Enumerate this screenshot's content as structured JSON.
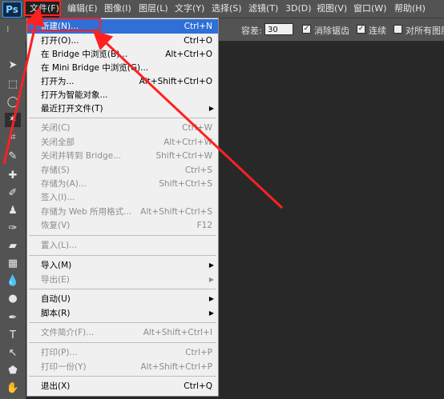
{
  "app": {
    "logo": "Ps"
  },
  "menubar": {
    "items": [
      "文件(F)",
      "编辑(E)",
      "图像(I)",
      "图层(L)",
      "文字(Y)",
      "选择(S)",
      "滤镜(T)",
      "3D(D)",
      "视图(V)",
      "窗口(W)",
      "帮助(H)"
    ]
  },
  "options": {
    "tolerance_label": "容差:",
    "tolerance_value": "30",
    "antialias_label": "消除锯齿",
    "contiguous_label": "连续",
    "all_layers_label": "对所有图层"
  },
  "file_menu": {
    "items": [
      {
        "label": "新建(N)...",
        "shortcut": "Ctrl+N",
        "state": "highlighted"
      },
      {
        "label": "打开(O)...",
        "shortcut": "Ctrl+O"
      },
      {
        "label": "在 Bridge 中浏览(B)...",
        "shortcut": "Alt+Ctrl+O"
      },
      {
        "label": "在 Mini Bridge 中浏览(G)...",
        "shortcut": ""
      },
      {
        "label": "打开为...",
        "shortcut": "Alt+Shift+Ctrl+O"
      },
      {
        "label": "打开为智能对象...",
        "shortcut": ""
      },
      {
        "label": "最近打开文件(T)",
        "shortcut": "",
        "submenu": true
      },
      {
        "label": "关闭(C)",
        "shortcut": "Ctrl+W",
        "state": "disabled"
      },
      {
        "label": "关闭全部",
        "shortcut": "Alt+Ctrl+W",
        "state": "disabled"
      },
      {
        "label": "关闭并转到 Bridge...",
        "shortcut": "Shift+Ctrl+W",
        "state": "disabled"
      },
      {
        "label": "存储(S)",
        "shortcut": "Ctrl+S",
        "state": "disabled"
      },
      {
        "label": "存储为(A)...",
        "shortcut": "Shift+Ctrl+S",
        "state": "disabled"
      },
      {
        "label": "签入(I)...",
        "shortcut": "",
        "state": "disabled"
      },
      {
        "label": "存储为 Web 所用格式...",
        "shortcut": "Alt+Shift+Ctrl+S",
        "state": "disabled"
      },
      {
        "label": "恢复(V)",
        "shortcut": "F12",
        "state": "disabled"
      },
      {
        "label": "置入(L)...",
        "shortcut": "",
        "state": "disabled"
      },
      {
        "label": "导入(M)",
        "shortcut": "",
        "submenu": true
      },
      {
        "label": "导出(E)",
        "shortcut": "",
        "submenu": true,
        "state": "disabled"
      },
      {
        "label": "自动(U)",
        "shortcut": "",
        "submenu": true
      },
      {
        "label": "脚本(R)",
        "shortcut": "",
        "submenu": true
      },
      {
        "label": "文件简介(F)...",
        "shortcut": "Alt+Shift+Ctrl+I",
        "state": "disabled"
      },
      {
        "label": "打印(P)...",
        "shortcut": "Ctrl+P",
        "state": "disabled"
      },
      {
        "label": "打印一份(Y)",
        "shortcut": "Alt+Shift+Ctrl+P",
        "state": "disabled"
      },
      {
        "label": "退出(X)",
        "shortcut": "Ctrl+Q"
      }
    ]
  },
  "colors": {
    "highlight": "#2f6fd6",
    "annotation": "#ff2020",
    "workspace": "#282828"
  }
}
